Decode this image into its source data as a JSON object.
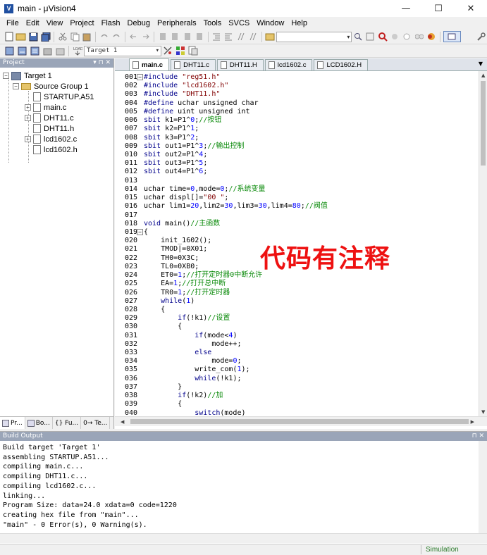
{
  "window": {
    "title": "main - μVision4",
    "icon_letter": "V",
    "minimize": "—",
    "maximize": "☐",
    "close": "✕"
  },
  "menu": [
    "File",
    "Edit",
    "View",
    "Project",
    "Flash",
    "Debug",
    "Peripherals",
    "Tools",
    "SVCS",
    "Window",
    "Help"
  ],
  "toolbar2": {
    "target_combo": "Target 1"
  },
  "project_panel": {
    "title": "Project",
    "tree": {
      "target": "Target 1",
      "group": "Source Group 1",
      "files": [
        "STARTUP.A51",
        "main.c",
        "DHT11.c",
        "DHT11.h",
        "lcd1602.c",
        "lcd1602.h"
      ]
    },
    "tabs": [
      "Pr...",
      "Bo...",
      "{} Fu...",
      "0→ Te..."
    ]
  },
  "editor": {
    "tabs": [
      "main.c",
      "DHT11.c",
      "DHT11.H",
      "lcd1602.c",
      "LCD1602.H"
    ],
    "active_tab": "main.c",
    "annotation": "代码有注释",
    "lines": [
      {
        "n": "001",
        "fold": "-",
        "segs": [
          [
            "pp",
            "#include "
          ],
          [
            "str",
            "\"reg51.h\""
          ]
        ]
      },
      {
        "n": "002",
        "segs": [
          [
            "pp",
            "#include "
          ],
          [
            "str",
            "\"lcd1602.h\""
          ]
        ]
      },
      {
        "n": "003",
        "segs": [
          [
            "pp",
            "#include "
          ],
          [
            "str",
            "\"DHT11.h\""
          ]
        ]
      },
      {
        "n": "004",
        "segs": [
          [
            "pp",
            "#define "
          ],
          [
            "t",
            "uchar unsigned char"
          ]
        ]
      },
      {
        "n": "005",
        "segs": [
          [
            "pp",
            "#define "
          ],
          [
            "t",
            "uint unsigned int"
          ]
        ]
      },
      {
        "n": "006",
        "segs": [
          [
            "kw",
            "sbit"
          ],
          [
            "t",
            " k1=P1^"
          ],
          [
            "num",
            "0"
          ],
          [
            "t",
            ";"
          ],
          [
            "cmt",
            "//按钮"
          ]
        ]
      },
      {
        "n": "007",
        "segs": [
          [
            "kw",
            "sbit"
          ],
          [
            "t",
            " k2=P1^"
          ],
          [
            "num",
            "1"
          ],
          [
            "t",
            ";"
          ]
        ]
      },
      {
        "n": "008",
        "segs": [
          [
            "kw",
            "sbit"
          ],
          [
            "t",
            " k3=P1^"
          ],
          [
            "num",
            "2"
          ],
          [
            "t",
            ";"
          ]
        ]
      },
      {
        "n": "009",
        "segs": [
          [
            "kw",
            "sbit"
          ],
          [
            "t",
            " out1=P1^"
          ],
          [
            "num",
            "3"
          ],
          [
            "t",
            ";"
          ],
          [
            "cmt",
            "//输出控制"
          ]
        ]
      },
      {
        "n": "010",
        "segs": [
          [
            "kw",
            "sbit"
          ],
          [
            "t",
            " out2=P1^"
          ],
          [
            "num",
            "4"
          ],
          [
            "t",
            ";"
          ]
        ]
      },
      {
        "n": "011",
        "segs": [
          [
            "kw",
            "sbit"
          ],
          [
            "t",
            " out3=P1^"
          ],
          [
            "num",
            "5"
          ],
          [
            "t",
            ";"
          ]
        ]
      },
      {
        "n": "012",
        "segs": [
          [
            "kw",
            "sbit"
          ],
          [
            "t",
            " out4=P1^"
          ],
          [
            "num",
            "6"
          ],
          [
            "t",
            ";"
          ]
        ]
      },
      {
        "n": "013",
        "segs": []
      },
      {
        "n": "014",
        "segs": [
          [
            "t",
            "uchar time="
          ],
          [
            "num",
            "0"
          ],
          [
            "t",
            ",mode="
          ],
          [
            "num",
            "0"
          ],
          [
            "t",
            ";"
          ],
          [
            "cmt",
            "//系统变量"
          ]
        ]
      },
      {
        "n": "015",
        "segs": [
          [
            "t",
            "uchar displ[]="
          ],
          [
            "str",
            "\"00 \""
          ],
          [
            "t",
            ";"
          ]
        ]
      },
      {
        "n": "016",
        "segs": [
          [
            "t",
            "uchar lim1="
          ],
          [
            "num",
            "20"
          ],
          [
            "t",
            ",lim2="
          ],
          [
            "num",
            "30"
          ],
          [
            "t",
            ",lim3="
          ],
          [
            "num",
            "30"
          ],
          [
            "t",
            ",lim4="
          ],
          [
            "num",
            "80"
          ],
          [
            "t",
            ";"
          ],
          [
            "cmt",
            "//阀值"
          ]
        ]
      },
      {
        "n": "017",
        "segs": []
      },
      {
        "n": "018",
        "segs": [
          [
            "kw",
            "void"
          ],
          [
            "t",
            " main()"
          ],
          [
            "cmt",
            "//主函数"
          ]
        ]
      },
      {
        "n": "019",
        "fold": "-",
        "segs": [
          [
            "t",
            "{"
          ]
        ]
      },
      {
        "n": "020",
        "segs": [
          [
            "t",
            "    init_1602();"
          ]
        ]
      },
      {
        "n": "021",
        "segs": [
          [
            "t",
            "    TMOD|=0X01;"
          ]
        ]
      },
      {
        "n": "022",
        "segs": [
          [
            "t",
            "    TH0=0X3C;"
          ]
        ]
      },
      {
        "n": "023",
        "segs": [
          [
            "t",
            "    TL0=0XB0;"
          ]
        ]
      },
      {
        "n": "024",
        "segs": [
          [
            "t",
            "    ET0="
          ],
          [
            "num",
            "1"
          ],
          [
            "t",
            ";"
          ],
          [
            "cmt",
            "//打开定时器0中断允许"
          ]
        ]
      },
      {
        "n": "025",
        "segs": [
          [
            "t",
            "    EA="
          ],
          [
            "num",
            "1"
          ],
          [
            "t",
            ";"
          ],
          [
            "cmt",
            "//打开总中断"
          ]
        ]
      },
      {
        "n": "026",
        "segs": [
          [
            "t",
            "    TR0="
          ],
          [
            "num",
            "1"
          ],
          [
            "t",
            ";"
          ],
          [
            "cmt",
            "//打开定时器"
          ]
        ]
      },
      {
        "n": "027",
        "segs": [
          [
            "t",
            "    "
          ],
          [
            "kw",
            "while"
          ],
          [
            "t",
            "("
          ],
          [
            "num",
            "1"
          ],
          [
            "t",
            ")"
          ]
        ]
      },
      {
        "n": "028",
        "segs": [
          [
            "t",
            "    {"
          ]
        ]
      },
      {
        "n": "029",
        "segs": [
          [
            "t",
            "        "
          ],
          [
            "kw",
            "if"
          ],
          [
            "t",
            "(!k1)"
          ],
          [
            "cmt",
            "//设置"
          ]
        ]
      },
      {
        "n": "030",
        "segs": [
          [
            "t",
            "        {"
          ]
        ]
      },
      {
        "n": "031",
        "segs": [
          [
            "t",
            "            "
          ],
          [
            "kw",
            "if"
          ],
          [
            "t",
            "(mode<"
          ],
          [
            "num",
            "4"
          ],
          [
            "t",
            ")"
          ]
        ]
      },
      {
        "n": "032",
        "segs": [
          [
            "t",
            "                mode++;"
          ]
        ]
      },
      {
        "n": "033",
        "segs": [
          [
            "t",
            "            "
          ],
          [
            "kw",
            "else"
          ]
        ]
      },
      {
        "n": "034",
        "segs": [
          [
            "t",
            "                mode="
          ],
          [
            "num",
            "0"
          ],
          [
            "t",
            ";"
          ]
        ]
      },
      {
        "n": "035",
        "segs": [
          [
            "t",
            "            write_com("
          ],
          [
            "num",
            "1"
          ],
          [
            "t",
            ");"
          ]
        ]
      },
      {
        "n": "036",
        "segs": [
          [
            "t",
            "            "
          ],
          [
            "kw",
            "while"
          ],
          [
            "t",
            "(!k1);"
          ]
        ]
      },
      {
        "n": "037",
        "segs": [
          [
            "t",
            "        }"
          ]
        ]
      },
      {
        "n": "038",
        "segs": [
          [
            "t",
            "        "
          ],
          [
            "kw",
            "if"
          ],
          [
            "t",
            "(!k2)"
          ],
          [
            "cmt",
            "//加"
          ]
        ]
      },
      {
        "n": "039",
        "segs": [
          [
            "t",
            "        {"
          ]
        ]
      },
      {
        "n": "040",
        "segs": [
          [
            "t",
            "            "
          ],
          [
            "kw",
            "switch"
          ],
          [
            "t",
            "(mode)"
          ]
        ]
      }
    ]
  },
  "build_output": {
    "title": "Build Output",
    "lines": [
      "Build target 'Target 1'",
      "assembling STARTUP.A51...",
      "compiling main.c...",
      "compiling DHT11.c...",
      "compiling lcd1602.c...",
      "linking...",
      "Program Size: data=24.0 xdata=0 code=1220",
      "creating hex file from \"main\"...",
      "\"main\" - 0 Error(s), 0 Warning(s)."
    ]
  },
  "status": {
    "mode": "Simulation"
  }
}
